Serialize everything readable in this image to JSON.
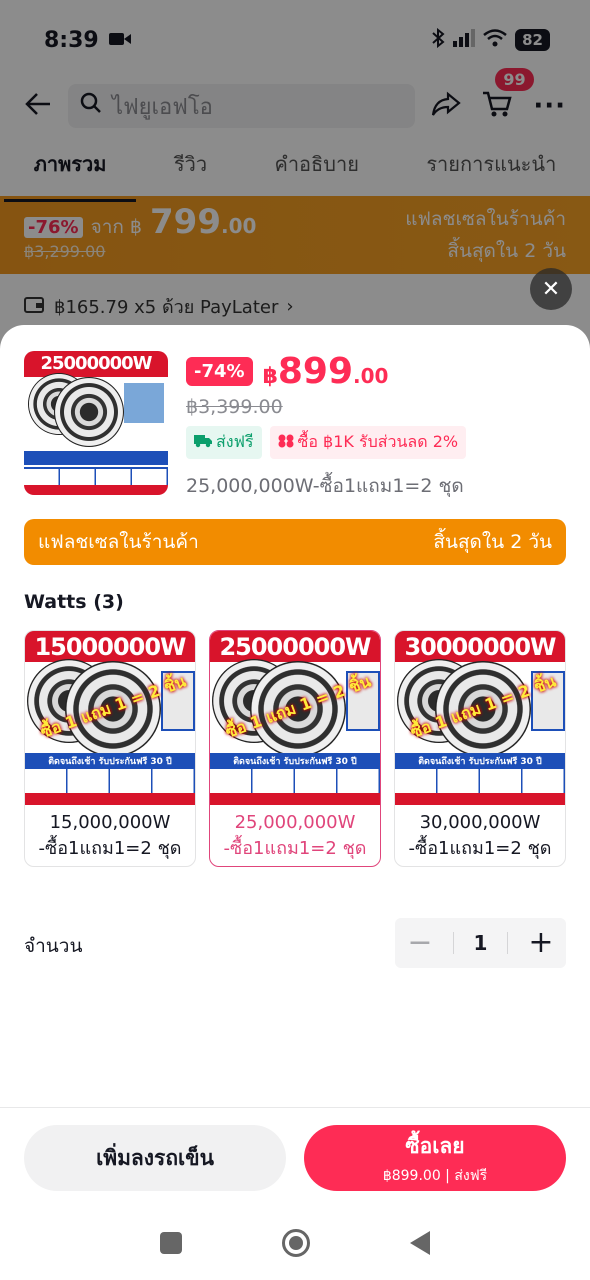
{
  "status_bar": {
    "time": "8:39",
    "battery": "82"
  },
  "search": {
    "placeholder": "ไฟยูเอฟโอ"
  },
  "cart": {
    "badge": "99"
  },
  "tabs": [
    {
      "label": "ภาพรวม"
    },
    {
      "label": "รีวิว"
    },
    {
      "label": "คำอธิบาย"
    },
    {
      "label": "รายการแนะนำ"
    }
  ],
  "bg_flash": {
    "discount": "-76%",
    "from": "จาก ฿",
    "price": "799",
    "price_dec": ".00",
    "old_price": "฿3,299.00",
    "title": "แฟลชเซลในร้านค้า",
    "ends": "สิ้นสุดใน 2 วัน"
  },
  "paylater": {
    "text": "฿165.79 x5 ด้วย PayLater"
  },
  "close": {
    "symbol": "✕"
  },
  "product": {
    "discount": "-74%",
    "currency": "฿",
    "price": "899",
    "price_dec": ".00",
    "old_price": "฿3,399.00",
    "free_shipping": "ส่งฟรี",
    "promo": "ซื้อ ฿1K รับส่วนลด 2%",
    "selected_variant": "25,000,000W-ซื้อ1แถม1=2 ชุด",
    "image_title": "25000000W"
  },
  "flash_sale": {
    "title": "แฟลชเซลในร้านค้า",
    "ends": "สิ้นสุดใน 2 วัน"
  },
  "watts": {
    "label": "Watts (3)",
    "options": [
      {
        "image_title": "15000000W",
        "line1": "15,000,000W",
        "line2": "-ซื้อ1แถม1=2 ชุด"
      },
      {
        "image_title": "25000000W",
        "line1": "25,000,000W",
        "line2": "-ซื้อ1แถม1=2 ชุด"
      },
      {
        "image_title": "30000000W",
        "line1": "30,000,000W",
        "line2": "-ซื้อ1แถม1=2 ชุด"
      }
    ]
  },
  "quantity": {
    "label": "จำนวน",
    "value": "1",
    "minus": "−",
    "plus": "+"
  },
  "actions": {
    "add_to_cart": "เพิ่มลงรถเข็น",
    "buy_now": "ซื้อเลย",
    "buy_sub": "฿899.00 | ส่งฟรี"
  },
  "colors": {
    "accent": "#fe2c55",
    "flash": "#f28c00",
    "selected_variant": "#e0457b"
  }
}
